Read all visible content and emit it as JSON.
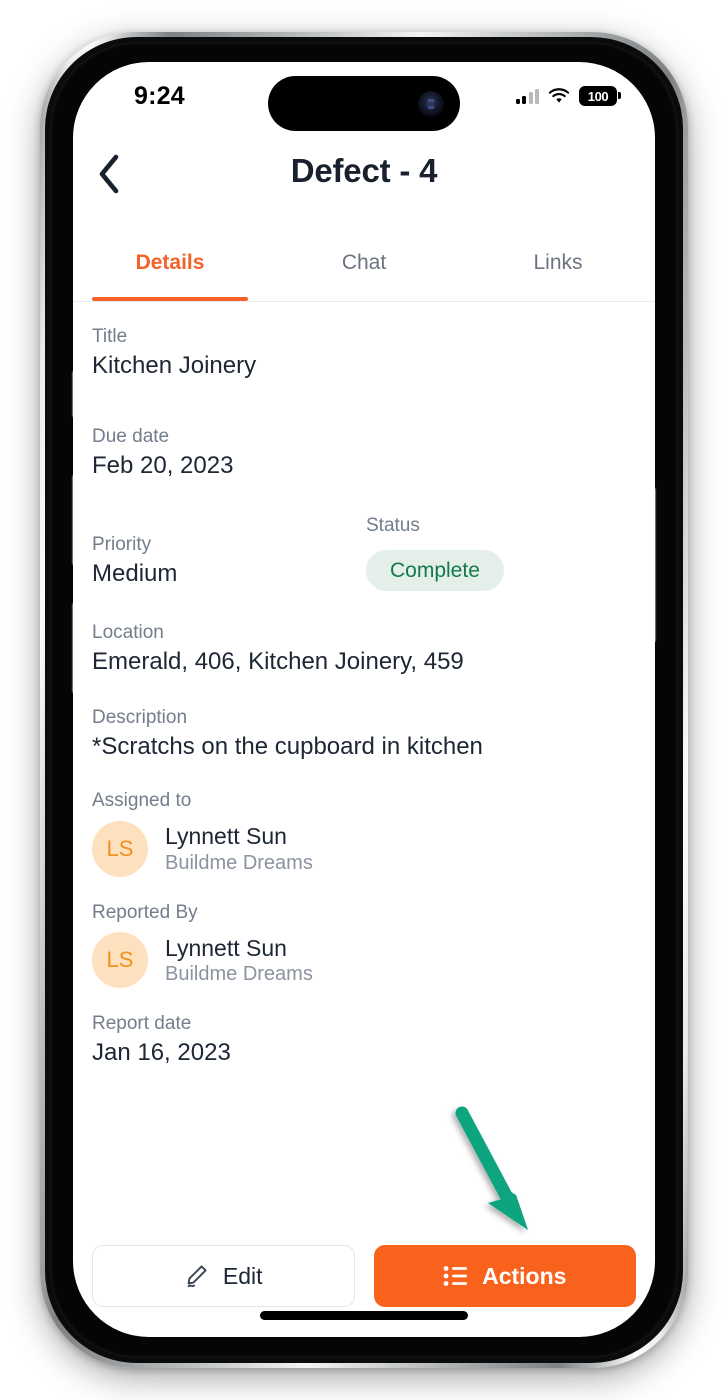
{
  "device": {
    "status_bar": {
      "time": "9:24",
      "battery_level": "100",
      "signal_icon": "cellular-bars-icon",
      "wifi_icon": "wifi-icon",
      "battery_icon": "battery-icon"
    },
    "home_indicator": "home-indicator"
  },
  "header": {
    "back_icon": "chevron-left-icon",
    "title": "Defect - 4"
  },
  "tabs": [
    {
      "label": "Details",
      "active": true
    },
    {
      "label": "Chat",
      "active": false
    },
    {
      "label": "Links",
      "active": false
    }
  ],
  "details": {
    "title": {
      "label": "Title",
      "value": "Kitchen Joinery"
    },
    "due_date": {
      "label": "Due date",
      "value": "Feb 20, 2023"
    },
    "priority": {
      "label": "Priority",
      "value": "Medium"
    },
    "status": {
      "label": "Status",
      "value": "Complete"
    },
    "location": {
      "label": "Location",
      "value": "Emerald, 406, Kitchen Joinery, 459"
    },
    "description": {
      "label": "Description",
      "value": "*Scratchs on the cupboard in kitchen"
    },
    "assigned_to": {
      "label": "Assigned to",
      "initials": "LS",
      "name": "Lynnett Sun",
      "organization": "Buildme Dreams"
    },
    "reported_by": {
      "label": "Reported By",
      "initials": "LS",
      "name": "Lynnett Sun",
      "organization": "Buildme Dreams"
    },
    "report_date": {
      "label": "Report date",
      "value": "Jan 16, 2023"
    }
  },
  "action_bar": {
    "edit": {
      "label": "Edit",
      "icon": "pencil-icon"
    },
    "actions": {
      "label": "Actions",
      "icon": "list-icon"
    }
  },
  "annotation": {
    "arrow_icon": "arrow-pointing-to-actions-button",
    "arrow_color": "#0ea57f"
  },
  "colors": {
    "accent_orange": "#f9621d",
    "tab_active": "#f4622a",
    "text_primary": "#1d2635",
    "text_muted": "#737d8c",
    "status_badge_bg": "#e5efe9",
    "status_badge_text": "#13794a",
    "avatar_bg": "#fde0bd",
    "avatar_text": "#f0921f"
  }
}
